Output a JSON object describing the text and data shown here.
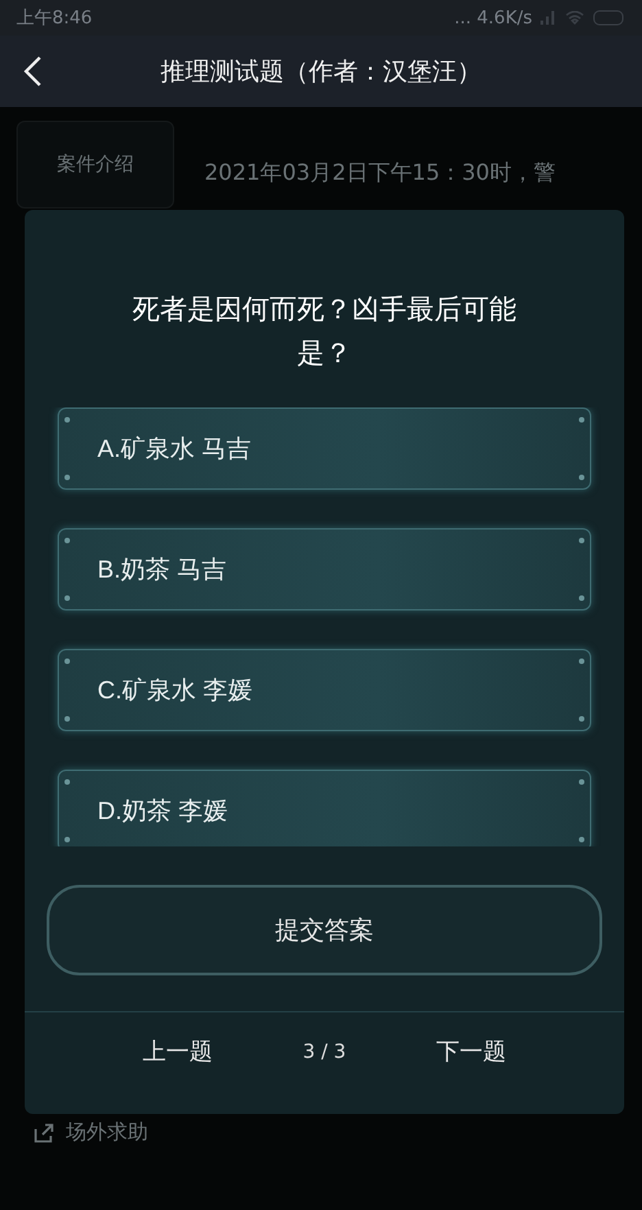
{
  "status_bar": {
    "time": "上午8:46",
    "speed": "... 4.6K/s"
  },
  "header": {
    "title": "推理测试题（作者：汉堡汪）"
  },
  "sidebar": {
    "items": [
      "案件介绍"
    ]
  },
  "case_text": "2021年03月2日下午15：30时，警",
  "help_link": "场外求助",
  "dialog": {
    "question": "死者是因何而死？凶手最后可能是？",
    "options": [
      "A.矿泉水 马吉",
      "B.奶茶 马吉",
      "C.矿泉水 李媛",
      "D.奶茶 李媛"
    ],
    "submit": "提交答案",
    "prev": "上一题",
    "page": "3 / 3",
    "next": "下一题"
  }
}
